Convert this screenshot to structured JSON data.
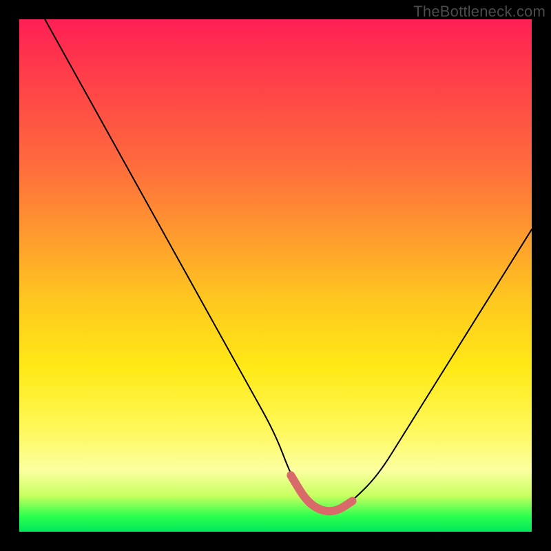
{
  "watermark": "TheBottleneck.com",
  "chart_data": {
    "type": "line",
    "title": "",
    "xlabel": "",
    "ylabel": "",
    "xlim": [
      0,
      100
    ],
    "ylim": [
      0,
      100
    ],
    "series": [
      {
        "name": "black-curve",
        "x": [
          5,
          10,
          15,
          20,
          25,
          30,
          35,
          40,
          45,
          50,
          53,
          56,
          59,
          62,
          65,
          70,
          75,
          80,
          85,
          90,
          95,
          100
        ],
        "values": [
          100,
          91,
          82,
          73,
          64,
          55,
          46,
          37,
          28,
          19,
          11,
          6,
          4,
          4,
          6,
          11,
          19,
          27,
          35,
          43,
          51,
          59
        ]
      },
      {
        "name": "valley-highlight",
        "x": [
          53,
          56,
          59,
          62,
          65
        ],
        "values": [
          11,
          6,
          4,
          4,
          6
        ]
      }
    ],
    "colors": {
      "curve": "#000000",
      "highlight": "#d96a6a"
    }
  }
}
